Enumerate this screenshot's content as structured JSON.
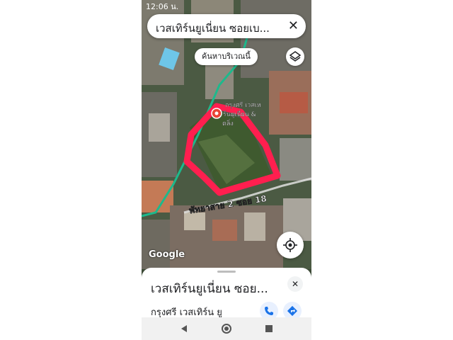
{
  "status_bar": {
    "time": "12:06 น."
  },
  "search": {
    "query": "เวสเทิร์นยูเนี่ยน ซอยเบ..."
  },
  "map": {
    "search_area_chip": "ค้นหาบริเวณนี้",
    "road_label": "พัทยาสาย 2 ซอย 18",
    "poi_label_lines": [
      "กรุงศรี เวสเท",
      "ร์นยูเนี่ยน &",
      "ตลิ่ง"
    ],
    "attribution": "Google",
    "colors": {
      "boundary": "#ff1f4f",
      "road": "#1db98c",
      "pin": "#ea4335"
    }
  },
  "place_sheet": {
    "title": "เวสเทิร์นยูเนี่ยน ซอย...",
    "subtitle": "กรุงศรี เวสเทิร์น ยู"
  },
  "icons": [
    "close-icon",
    "layers-icon",
    "my-location-icon",
    "phone-icon",
    "directions-icon",
    "back-icon",
    "home-icon",
    "recents-icon",
    "map-pin-icon"
  ]
}
